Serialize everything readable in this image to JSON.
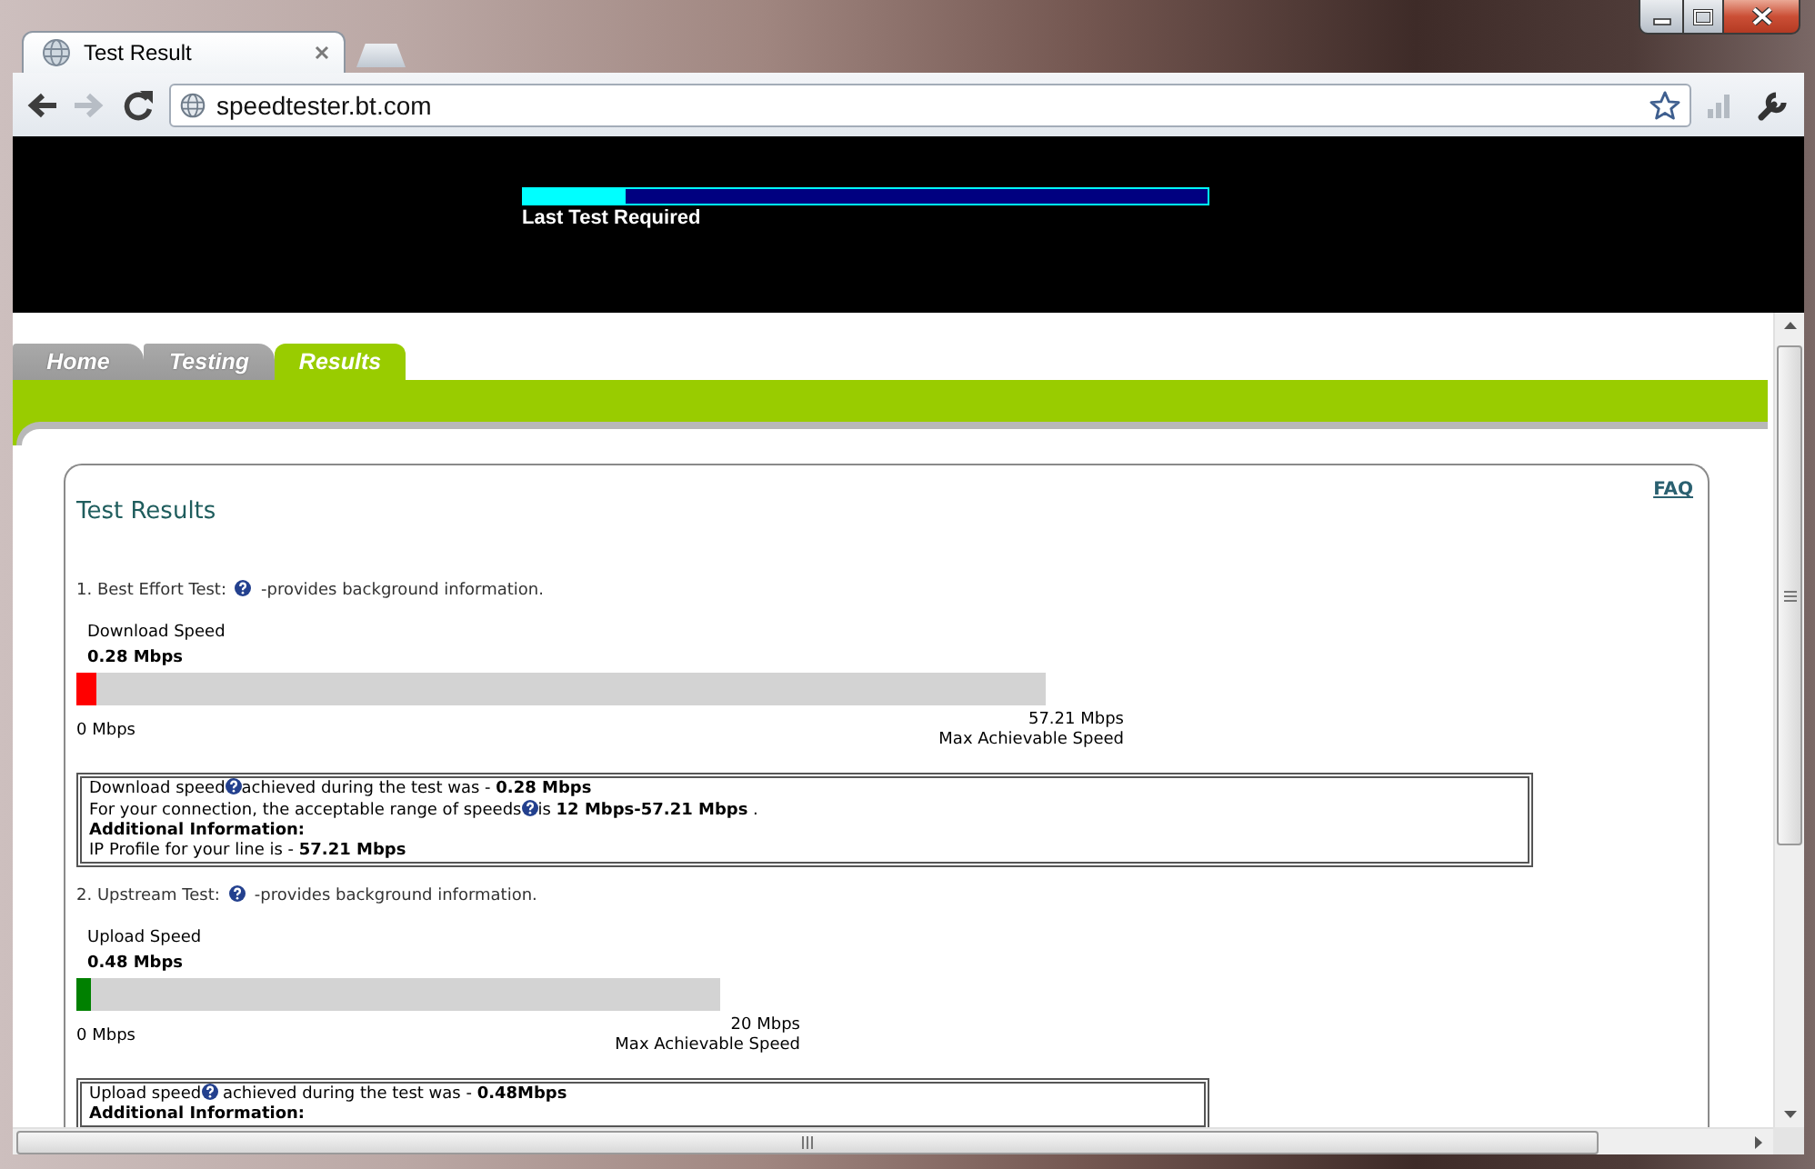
{
  "browser": {
    "tabs": [
      {
        "title": "Test Result",
        "selected": true
      }
    ],
    "nav_buttons": [
      {
        "kind": "back",
        "disabled": false
      },
      {
        "kind": "forward",
        "disabled": true
      },
      {
        "kind": "reload",
        "disabled": false
      }
    ],
    "address": "speedtester.bt.com"
  },
  "header": {
    "progress": {
      "level": 0.15
    },
    "status": "Last Test Required"
  },
  "site_tabs": [
    {
      "label": "Home",
      "selected": false
    },
    {
      "label": "Testing",
      "selected": false
    },
    {
      "label": "Results",
      "selected": true
    }
  ],
  "results": {
    "title": "Test Results",
    "faq_link": "FAQ",
    "tests": [
      {
        "kind": "download",
        "heading": [
          "1. Best Effort Test:",
          "-provides background information."
        ],
        "gauge": {
          "label": "Download Speed",
          "reading": "0.28 Mbps",
          "level": 0.02,
          "color": "#ff0000",
          "min_label": "0 Mbps",
          "max_label": "57.21 Mbps",
          "max_caption": "Max Achievable Speed"
        },
        "info": [
          {
            "kind": "text",
            "parts": [
              "Download speed",
              "achieved during the test was - **0.28 Mbps**"
            ]
          },
          {
            "kind": "text",
            "parts": [
              "For your connection, the acceptable range of speeds",
              "is **12 Mbps-57.21 Mbps** ."
            ]
          },
          {
            "kind": "heading",
            "parts": [
              "Additional Information:"
            ]
          },
          {
            "kind": "text",
            "parts": [
              "IP Profile for your line is - **57.21 Mbps**"
            ]
          }
        ]
      },
      {
        "kind": "upload",
        "heading": [
          "2. Upstream Test:",
          "-provides background information."
        ],
        "gauge": {
          "label": "Upload Speed",
          "reading": "0.48 Mbps",
          "level": 0.023,
          "color": "#008000",
          "min_label": "0 Mbps",
          "max_label": "20 Mbps",
          "max_caption": "Max Achievable Speed"
        },
        "info": [
          {
            "kind": "text",
            "parts": [
              "Upload speed",
              " achieved during the test was - **0.48Mbps**"
            ]
          },
          {
            "kind": "heading",
            "parts": [
              "Additional Information:"
            ]
          }
        ]
      }
    ]
  }
}
